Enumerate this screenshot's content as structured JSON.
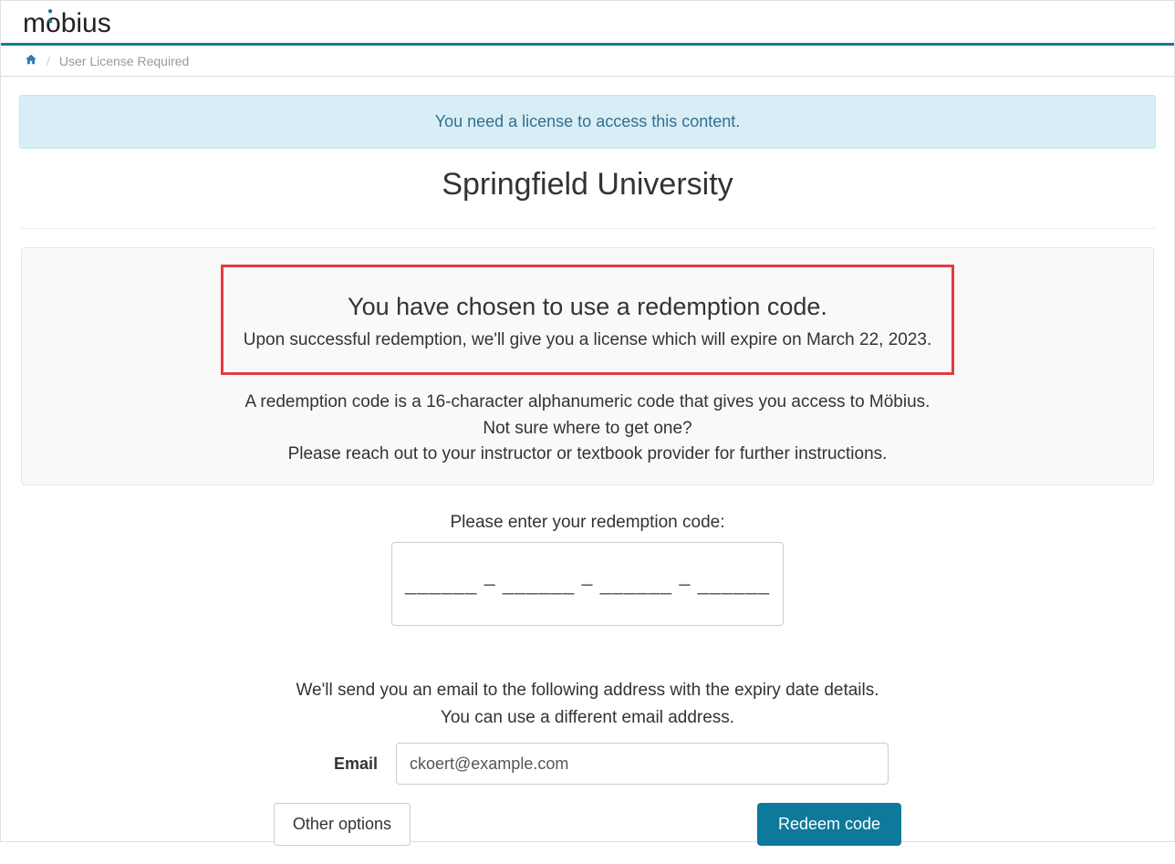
{
  "header": {
    "logo_text": "möbius"
  },
  "breadcrumb": {
    "current": "User License Required"
  },
  "alert": {
    "message": "You need a license to access this content."
  },
  "page": {
    "title": "Springfield University"
  },
  "highlight": {
    "heading": "You have chosen to use a redemption code.",
    "subtext": "Upon successful redemption, we'll give you a license which will expire on March 22, 2023."
  },
  "help": {
    "line1": "A redemption code is a 16-character alphanumeric code that gives you access to Möbius.",
    "line2": "Not sure where to get one?",
    "line3": "Please reach out to your instructor or textbook provider for further instructions."
  },
  "code_form": {
    "label": "Please enter your redemption code:",
    "placeholder": "______ – ______ – ______ – ______"
  },
  "email_section": {
    "info1": "We'll send you an email to the following address with the expiry date details.",
    "info2": "You can use a different email address.",
    "label": "Email",
    "value": "ckoert@example.com"
  },
  "buttons": {
    "other": "Other options",
    "redeem": "Redeem code"
  }
}
